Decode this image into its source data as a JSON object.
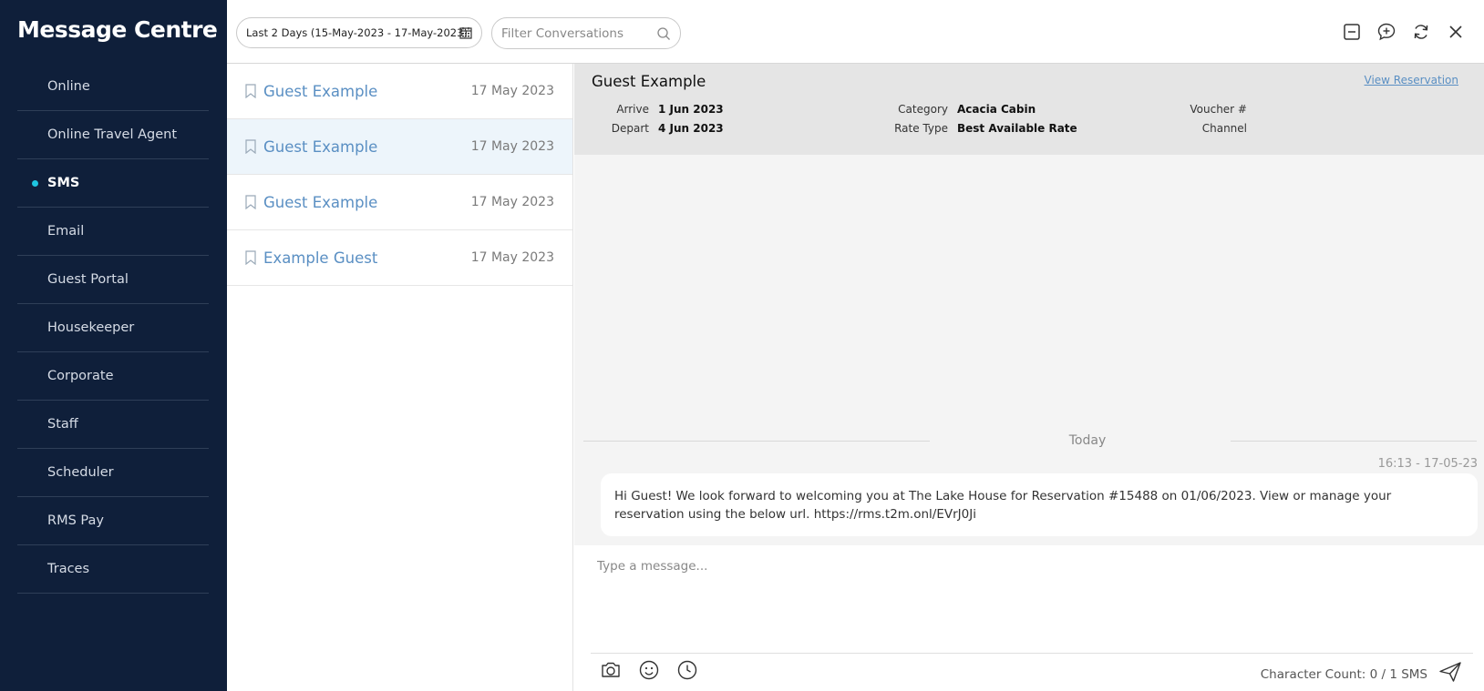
{
  "app": {
    "title": "Message Centre"
  },
  "sidebar": {
    "items": [
      {
        "label": "Online",
        "active": false
      },
      {
        "label": "Online Travel Agent",
        "active": false
      },
      {
        "label": "SMS",
        "active": true
      },
      {
        "label": "Email",
        "active": false
      },
      {
        "label": "Guest Portal",
        "active": false
      },
      {
        "label": "Housekeeper",
        "active": false
      },
      {
        "label": "Corporate",
        "active": false
      },
      {
        "label": "Staff",
        "active": false
      },
      {
        "label": "Scheduler",
        "active": false
      },
      {
        "label": "RMS Pay",
        "active": false
      },
      {
        "label": "Traces",
        "active": false
      }
    ],
    "active_color": "#1ec5e0"
  },
  "toolbar": {
    "date_range": "Last 2 Days (15-May-2023 - 17-May-2023)",
    "filter_placeholder": "Filter Conversations",
    "icons": [
      "minimize-icon",
      "new-message-icon",
      "refresh-icon",
      "close-icon"
    ]
  },
  "conversations": [
    {
      "name": "Guest Example",
      "date": "17 May 2023",
      "selected": false
    },
    {
      "name": "Guest Example",
      "date": "17 May 2023",
      "selected": true
    },
    {
      "name": "Guest Example",
      "date": "17 May 2023",
      "selected": false
    },
    {
      "name": "Example Guest",
      "date": "17 May 2023",
      "selected": false
    }
  ],
  "reservation": {
    "guest_name": "Guest Example",
    "view_link": "View Reservation",
    "arrive_label": "Arrive",
    "arrive_value": "1 Jun 2023",
    "depart_label": "Depart",
    "depart_value": "4 Jun 2023",
    "category_label": "Category",
    "category_value": "Acacia Cabin",
    "rate_type_label": "Rate Type",
    "rate_type_value": "Best Available Rate",
    "voucher_label": "Voucher #",
    "voucher_value": "",
    "channel_label": "Channel",
    "channel_value": ""
  },
  "thread": {
    "day_divider": "Today",
    "messages": [
      {
        "time": "16:13 - 17-05-23",
        "text": "Hi Guest! We look forward to welcoming you at The Lake House for Reservation #15488 on 01/06/2023. View or manage your reservation using the below url. https://rms.t2m.onl/EVrJ0Ji"
      }
    ]
  },
  "compose": {
    "placeholder": "Type a message...",
    "character_count": "Character Count: 0 / 1 SMS",
    "tool_icons": [
      "camera-icon",
      "emoji-icon",
      "clock-icon"
    ]
  },
  "colors": {
    "sidebar_bg": "#0f1f3a",
    "link": "#5a8fc3",
    "selected_row": "#edf5fb"
  }
}
